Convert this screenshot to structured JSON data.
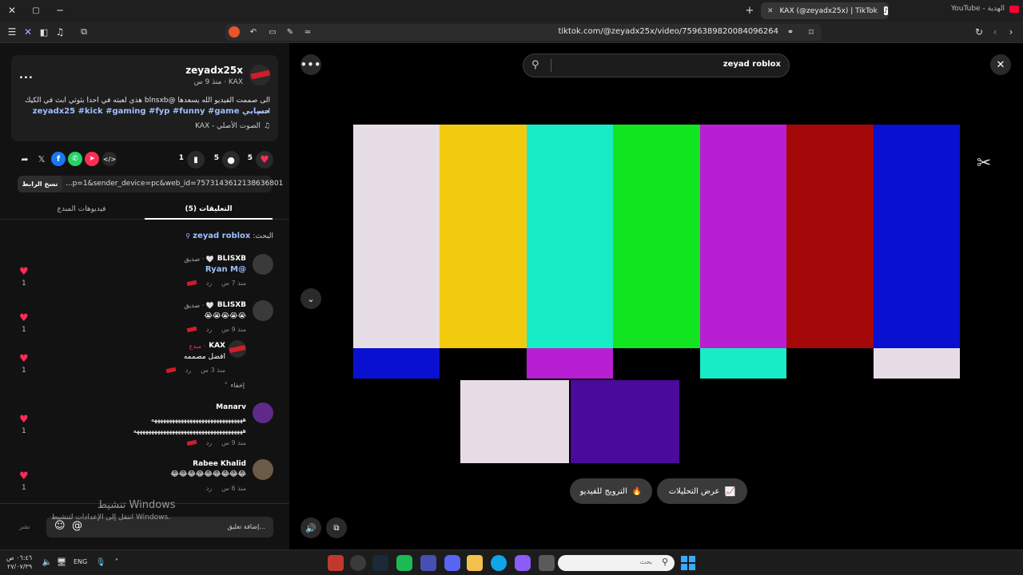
{
  "browser": {
    "tabs": [
      {
        "label": "KAX (@zeyadx25x) | TikTok"
      },
      {
        "label": "YouTube - الهدية"
      }
    ],
    "url": "tiktok.com/@zeyadx25x/video/7596389820084096264"
  },
  "post": {
    "username": "zeyadx25x",
    "meta": "KAX · منذ 9 س",
    "caption_line1": "الى صممت الفيديو الله يسعدها @blnsxb هذي لعبته في احدا بثوثي ابث في الكيك اسم",
    "caption_line2": "حسابي zeyadx25 #kick #gaming #fyp #funny #game",
    "sound": "الصوت الأصلي - KAX",
    "more_label": "...",
    "likes": "5",
    "comments": "5",
    "saves": "1",
    "link_text": "...p=1&sender_device=pc&web_id=7573143612138636801",
    "copy_label": "نسخ الرابط"
  },
  "tabs": [
    {
      "label": "التعليقات (5)"
    },
    {
      "label": "فيديوهات المبدع"
    }
  ],
  "search_hint": {
    "prefix": "البحث:",
    "term": "zeyad roblox"
  },
  "comments": [
    {
      "user": "BLISXB",
      "badge": "🤍 · صديق",
      "text": "@Ryan M",
      "time": "منذ 7 س",
      "reply": "رد",
      "likes": "1"
    },
    {
      "user": "BLISXB",
      "badge": "🤍 · صديق",
      "text": "😭😭😭😭😭",
      "time": "منذ 9 س",
      "reply": "رد",
      "likes": "1"
    },
    {
      "user": "KAX",
      "badge": "· مبدع",
      "text": "افضل مصممه",
      "time": "منذ 3 س",
      "reply": "رد",
      "likes": "1"
    },
    {
      "user": "Manarv",
      "badge": "",
      "text": "هههههههههههههههههههههههههههههههه",
      "text2": "هههههههههههههههههههههههههههههههههههههه",
      "time": "منذ 9 س",
      "reply": "رد",
      "likes": "1"
    },
    {
      "user": "Rabee Khalid",
      "badge": "",
      "text": "😂😂😂😂😂😂😂😂😂",
      "time": "منذ 6 س",
      "reply": "رد",
      "likes": "1"
    }
  ],
  "hide_label": "إخفاء",
  "comment_input": {
    "placeholder": "إضافة تعليق...",
    "post_label": "نشر"
  },
  "watermark": {
    "title": "تنشيط Windows",
    "sub": "انتقل إلى الإعدادات لتنشيط Windows."
  },
  "video": {
    "search_value": "zeyad roblox",
    "promote_label": "الترويج للفيديو",
    "analytics_label": "عرض التحليلات"
  },
  "colors": {
    "bars_top": [
      "#e6dde6",
      "#f2cb0e",
      "#18ecc6",
      "#10e520",
      "#b91fd2",
      "#a40808",
      "#0a10cf"
    ],
    "bars_mid": [
      "#0a10cf",
      "#000000",
      "#b91fd2",
      "#000000",
      "#18ecc6",
      "#000000",
      "#e6dde6"
    ],
    "accent": "#fe2c55"
  },
  "taskbar": {
    "search_placeholder": "بحث",
    "lang": "ENG",
    "time": "٠٦:٤٦ ص",
    "date": "٢٧/٠٧/٣٩"
  }
}
